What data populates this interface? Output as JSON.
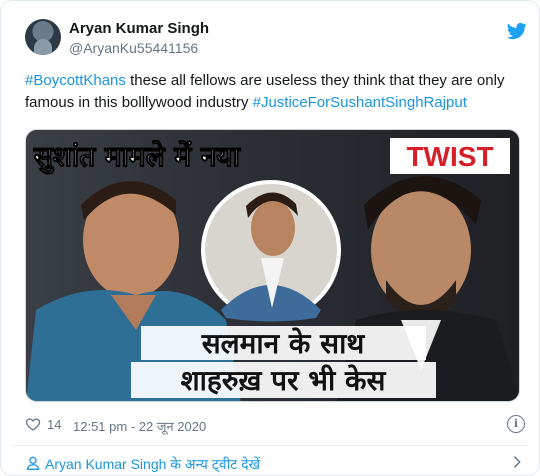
{
  "tweet": {
    "author_name": "Aryan Kumar Singh",
    "handle": "@AryanKu55441156",
    "hashtag1": "#BoycottKhans",
    "body_text": " these all fellows are useless they think that they are only famous in this bolllywood industry ",
    "hashtag2": "#JusticeForSushantSinghRajput"
  },
  "media": {
    "headline_top": "सुशांत मामले में नया",
    "twist": "TWIST",
    "caption_line1": "सलमान के साथ",
    "caption_line2": "शाहरुख़ पर भी केस"
  },
  "meta": {
    "likes": "14",
    "timestamp": "12:51 pm - 22 जून 2020",
    "info_icon": "i"
  },
  "footer": {
    "more_tweets": "Aryan Kumar Singh के अन्य ट्वीट देखें"
  },
  "colors": {
    "link": "#1b95e0",
    "secondary": "#657786",
    "twist_red": "#d61f26"
  },
  "icons": [
    "twitter-bird-icon",
    "heart-icon",
    "info-icon",
    "person-icon",
    "chevron-right-icon"
  ]
}
